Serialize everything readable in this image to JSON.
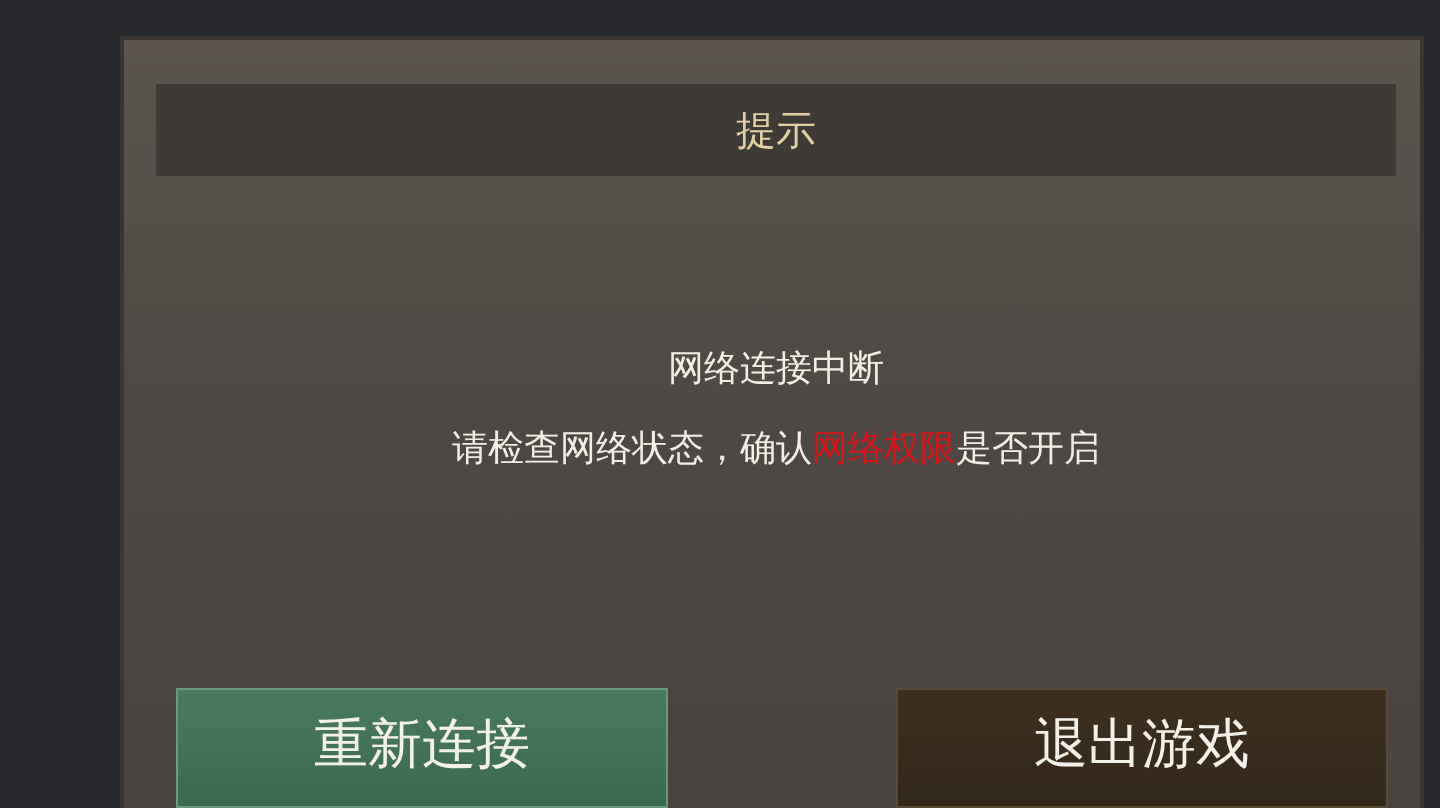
{
  "dialog": {
    "title": "提示",
    "message": [
      {
        "text": "网络连接中断",
        "highlight": false
      }
    ],
    "detail": [
      {
        "text": "请检查网络状态，确认",
        "highlight": false
      },
      {
        "text": "网络权限",
        "highlight": true
      },
      {
        "text": "是否开启",
        "highlight": false
      }
    ],
    "buttons": [
      {
        "label": "重新连接",
        "kind": "primary"
      },
      {
        "label": "退出游戏",
        "kind": "secondary"
      }
    ]
  }
}
